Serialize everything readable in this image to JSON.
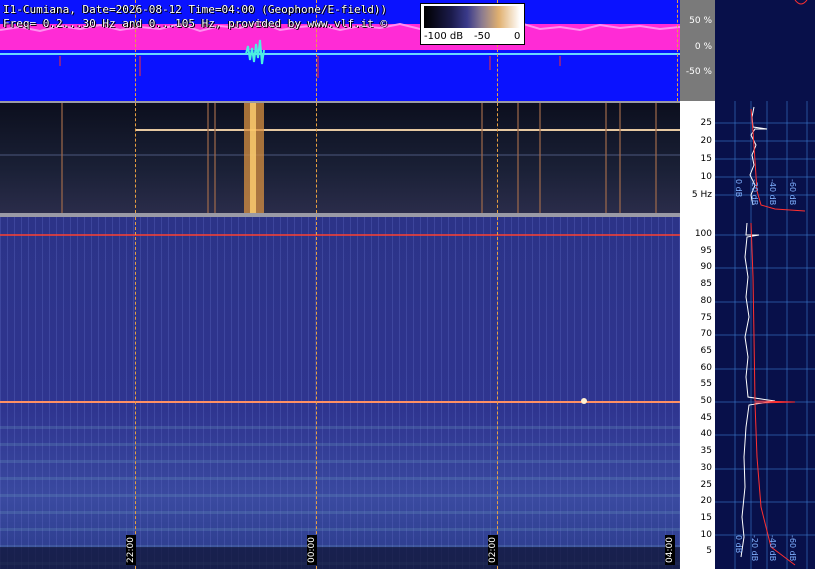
{
  "header": {
    "line1": "I1-Cumiana, Date=2026-08-12 Time=04:00 (Geophone/E-field))",
    "line2": "Freq= 0.2...30 Hz and 0...105 Hz, provided by www.vlf.it ©"
  },
  "colorbar": {
    "labels": [
      "-100 dB",
      "-50",
      "0"
    ]
  },
  "top_scale": {
    "labels": [
      "50 %",
      "0 %",
      "-50 %"
    ]
  },
  "mid_scale": {
    "labels": [
      "25",
      "20",
      "15",
      "10",
      "5 Hz"
    ]
  },
  "low_scale": {
    "labels": [
      "100",
      "95",
      "90",
      "85",
      "80",
      "75",
      "70",
      "65",
      "60",
      "55",
      "50",
      "45",
      "40",
      "35",
      "30",
      "25",
      "20",
      "15",
      "10",
      "5"
    ]
  },
  "time_axis": {
    "labels": [
      "22:00",
      "00:00",
      "02:00",
      "04:00"
    ]
  },
  "mini_graph_labels": {
    "mid": [
      "0 dB",
      "-20 dB",
      "-40 dB",
      "-60 dB"
    ],
    "low": [
      "0 dB",
      "-20 dB",
      "-40 dB",
      "-60 dB"
    ]
  },
  "colors": {
    "background_top": "#0a12ff",
    "signal_magenta": "#ff2bd6",
    "spectrogram_low": "#2a2f86",
    "spectrogram_mid": "#141828",
    "graph_bg": "#08104a",
    "marker_orange": "#e8a040",
    "hum_line": "#ff4030"
  }
}
